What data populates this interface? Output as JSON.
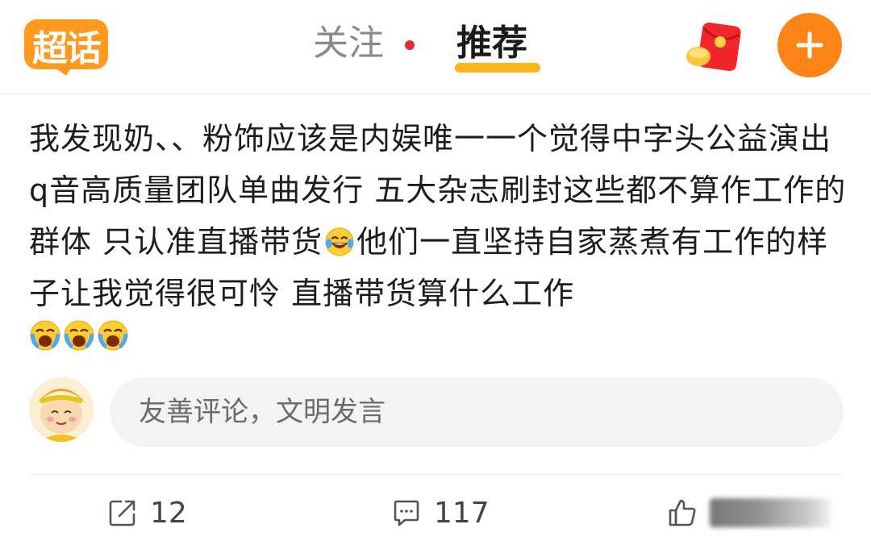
{
  "header": {
    "logo_text": "超话",
    "tabs": [
      {
        "label": "关注",
        "has_dot": true
      },
      {
        "label": "推荐",
        "active": true
      }
    ],
    "colors": {
      "accent": "#ffb41a",
      "plus": "#ff8418",
      "dot": "#e8293a",
      "logo": "#ff9a1f"
    },
    "icons": [
      "red-envelope-icon",
      "plus-icon"
    ]
  },
  "post": {
    "text": "我发现奶、、粉饰应该是内娱唯一一个觉得中字头公益演出 q音高质量团队单曲发行 五大杂志刷封这些都不算作工作的群体 只认准直播带货",
    "text_after_emoji": "他们一直坚持自家蒸煮有工作的样子让我觉得很可怜 直播带货算什么工作",
    "trailing_emoji_count": 3
  },
  "comment": {
    "placeholder": "友善评论，文明发言"
  },
  "actions": {
    "repost_count": "12",
    "comment_count": "117"
  }
}
